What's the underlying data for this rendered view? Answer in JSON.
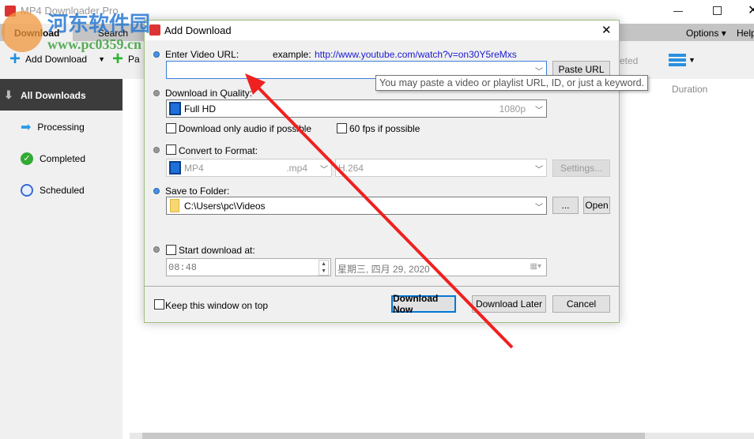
{
  "app": {
    "title": "MP4 Downloader Pro",
    "tabs": [
      "Download",
      "Search"
    ],
    "menu": [
      "Options",
      "Help"
    ]
  },
  "toolbar": {
    "add_download": "Add Download",
    "paste": "Pa",
    "completed_partial": "eted"
  },
  "sidebar": {
    "header": "All Downloads",
    "items": [
      "Processing",
      "Completed",
      "Scheduled"
    ]
  },
  "columns": {
    "duration": "Duration"
  },
  "watermark": {
    "name": "河东软件园",
    "url": "www.pc0359.cn"
  },
  "dialog": {
    "title": "Add Download",
    "url_label": "Enter Video URL:",
    "example_label": "example:",
    "example_url": "http://www.youtube.com/watch?v=on30Y5reMxs",
    "url_value": "",
    "paste_url": "Paste URL",
    "tooltip": "You may paste a video or playlist URL, ID, or just a keyword.",
    "quality_label": "Download in Quality:",
    "quality": "Full HD",
    "quality_res": "1080p",
    "audio_only": "Download only audio if possible",
    "fps60": "60 fps if possible",
    "convert_label": "Convert to Format:",
    "format": "MP4",
    "format_ext": ".mp4",
    "codec": "H.264",
    "settings": "Settings...",
    "folder_label": "Save to Folder:",
    "folder": "C:\\Users\\pc\\Videos",
    "browse": "...",
    "open": "Open",
    "start_label": "Start download at:",
    "time": "08:48",
    "date": "星期三,  四月   29, 2020",
    "keep_on_top": "Keep this window on top",
    "download_now": "Download Now",
    "download_later": "Download Later",
    "cancel": "Cancel"
  }
}
